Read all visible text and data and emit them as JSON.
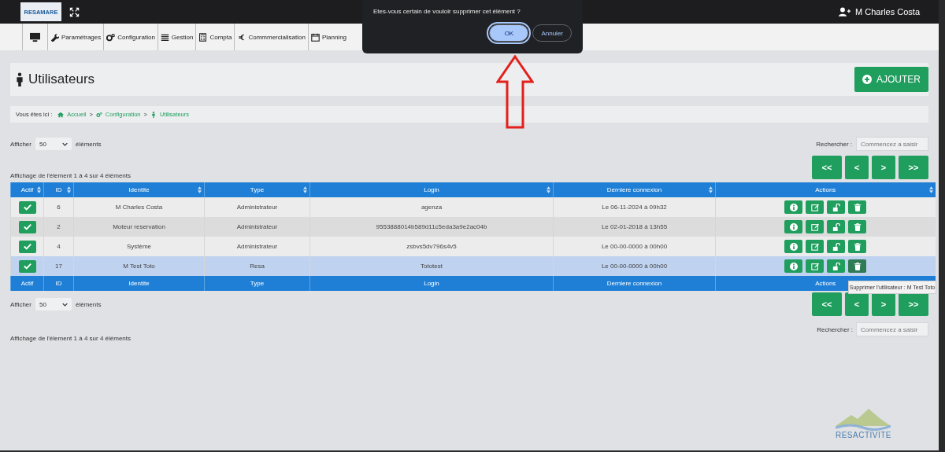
{
  "header": {
    "logo": "RESAMARE",
    "user": "M Charles Costa"
  },
  "nav": {
    "items": [
      "Paramétrages",
      "Configuration",
      "Gestion",
      "Compta",
      "Commmercialisation",
      "Planning"
    ]
  },
  "dialog": {
    "message": "Etes-vous certain de vouloir supprimer cet élément ?",
    "buttons": [
      {
        "label": "OK",
        "focused": true
      },
      {
        "label": "Annuler",
        "focused": false
      }
    ]
  },
  "page": {
    "title": "Utilisateurs",
    "add_button": "AJOUTER"
  },
  "breadcrumb": {
    "prefix": "Vous êtes ici :",
    "separator": ">",
    "items": [
      "Accueil",
      "Configuration",
      "Utilisateurs"
    ]
  },
  "top_controls": {
    "show_label": "Afficher",
    "page_size": "50",
    "suffix": "éléments",
    "search_label": "Rechercher :",
    "search_placeholder": "Commencez a saisir",
    "info": "Affichage de l'élement 1 à 4 sur 4 éléments",
    "pager": [
      "<<",
      "<",
      ">",
      ">>"
    ]
  },
  "table": {
    "columns": [
      {
        "label": "Actif",
        "sortable": true
      },
      {
        "label": "ID",
        "sortable": true
      },
      {
        "label": "Identite",
        "sortable": true
      },
      {
        "label": "Type",
        "sortable": true
      },
      {
        "label": "Login",
        "sortable": true
      },
      {
        "label": "Derniere connexion",
        "sortable": true
      },
      {
        "label": "Actions",
        "sortable": true
      }
    ],
    "rows": [
      {
        "active": true,
        "id": "6",
        "identity": "M Charles Costa",
        "type": "Administrateur",
        "login": "agenza",
        "last_login": "Le 06-11-2024 à 09h32",
        "selected": false,
        "delete_hovered": false
      },
      {
        "active": true,
        "id": "2",
        "identity": "Moteur reservation",
        "type": "Administrateur",
        "login": "9553888014b589d11c5eda3a9e2ac04b",
        "last_login": "Le 02-01-2018 à 13h55",
        "selected": false,
        "delete_hovered": false
      },
      {
        "active": true,
        "id": "4",
        "identity": "Système",
        "type": "Administrateur",
        "login": "zsbvs5dv796s4v5",
        "last_login": "Le 00-00-0000 à 00h00",
        "selected": false,
        "delete_hovered": false
      },
      {
        "active": true,
        "id": "17",
        "identity": "M Test Toto",
        "type": "Resa",
        "login": "Tototest",
        "last_login": "Le 00-00-0000 à 00h00",
        "selected": true,
        "delete_hovered": true
      }
    ],
    "footer_columns": [
      "Actif",
      "ID",
      "Identite",
      "Type",
      "Login",
      "Derniere connexion",
      "Actions"
    ]
  },
  "tooltip": "Supprimer l'utilisateur : M Test Toto",
  "bottom_controls": {
    "show_label": "Afficher",
    "page_size": "50",
    "suffix": "éléments",
    "search_label": "Rechercher :",
    "search_placeholder": "Commencez a saisir",
    "info": "Affichage de l'élement 1 à 4 sur 4 éléments",
    "pager": [
      "<<",
      "<",
      ">",
      ">>"
    ]
  },
  "footer_logo": "RESACTIVITE"
}
